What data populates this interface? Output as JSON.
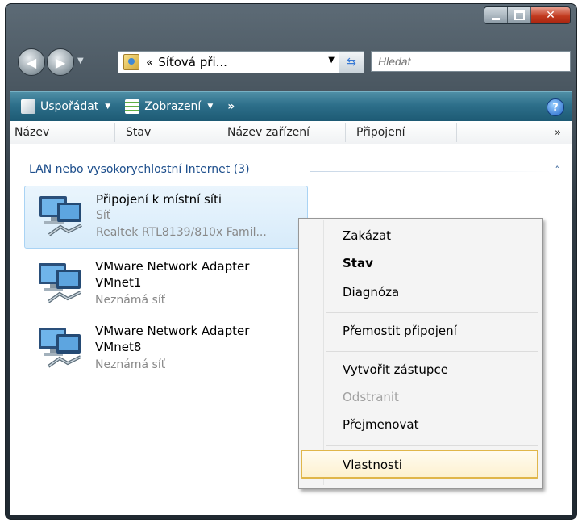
{
  "window": {
    "address_chevron": "«",
    "address_text": "Síťová při...",
    "search_placeholder": "Hledat"
  },
  "toolbar": {
    "organize_label": "Uspořádat",
    "view_label": "Zobrazení",
    "more_label": "»",
    "help_label": "?"
  },
  "columns": [
    "Název",
    "Stav",
    "Název zařízení",
    "Připojení"
  ],
  "columns_more": "»",
  "group": {
    "title": "LAN nebo vysokorychlostní Internet (3)",
    "collapse_glyph": "˄"
  },
  "items": [
    {
      "name": "Připojení k místní síti",
      "line1": "Síť",
      "line2": "Realtek RTL8139/810x Famil..."
    },
    {
      "name": "VMware Network Adapter VMnet1",
      "line1": "Neznámá síť"
    },
    {
      "name": "VMware Network Adapter VMnet8",
      "line1": "Neznámá síť"
    }
  ],
  "context_menu": {
    "items": [
      {
        "label": "Zakázat"
      },
      {
        "label": "Stav",
        "bold": true
      },
      {
        "label": "Diagnóza"
      },
      {
        "label": "Přemostit připojení"
      },
      {
        "label": "Vytvořit zástupce"
      },
      {
        "label": "Odstranit",
        "disabled": true
      },
      {
        "label": "Přejmenovat"
      },
      {
        "label": "Vlastnosti",
        "highlighted": true
      }
    ]
  },
  "colors": {
    "toolbar": "#2d6f8a",
    "selection": "#d7ebfa",
    "highlight_border": "#e0b64a",
    "group_text": "#1e4f8c"
  }
}
